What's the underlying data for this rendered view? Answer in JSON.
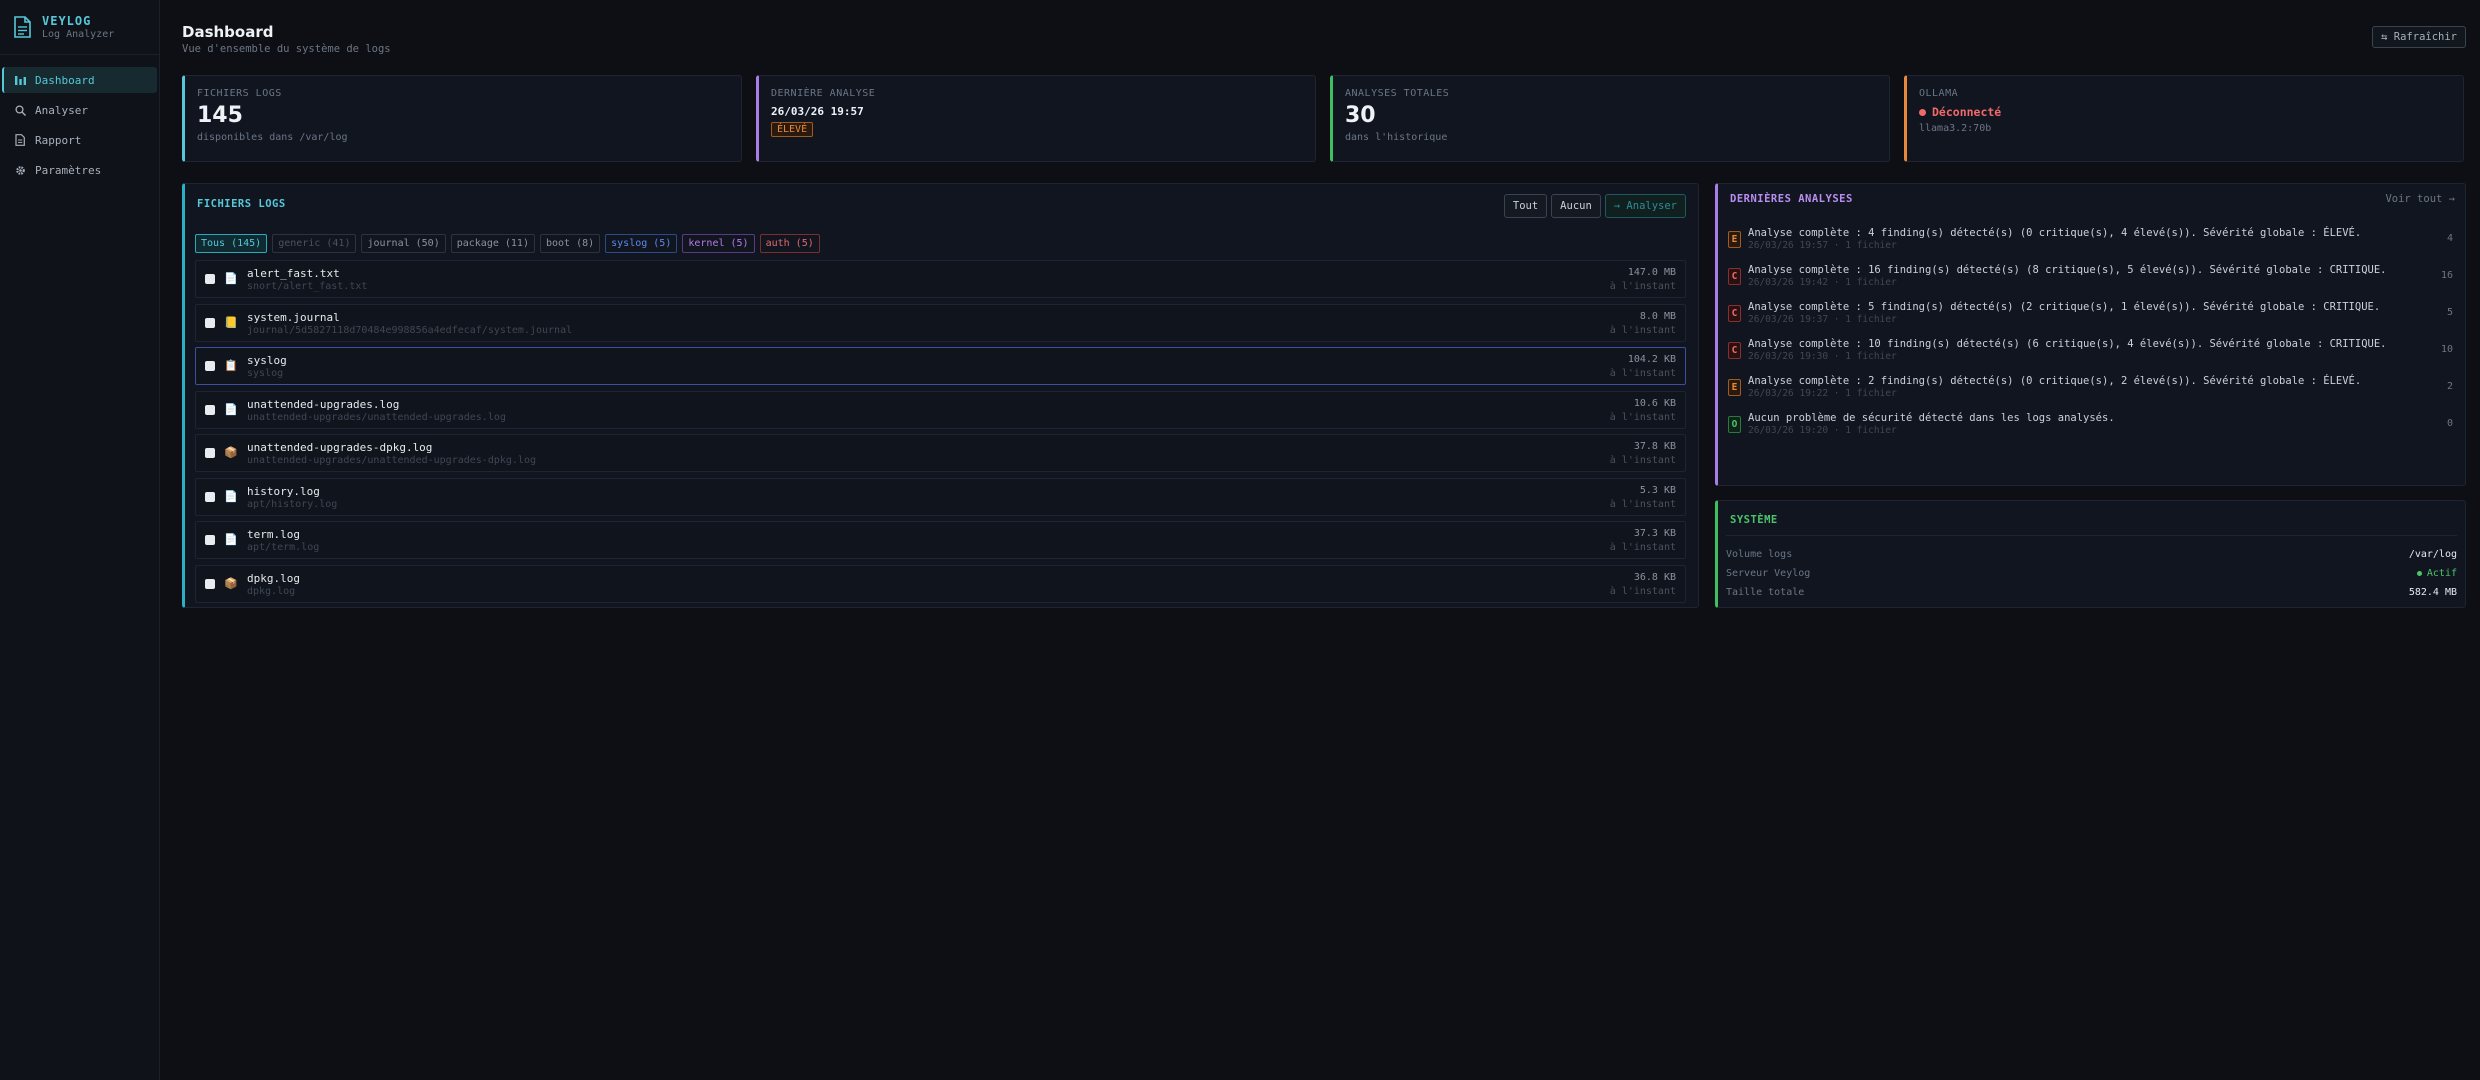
{
  "brand": {
    "name": "VEYLOG",
    "subtitle": "Log Analyzer"
  },
  "sidebar": {
    "items": [
      {
        "label": "Dashboard",
        "icon": "chart-icon",
        "active": true
      },
      {
        "label": "Analyser",
        "icon": "search-icon"
      },
      {
        "label": "Rapport",
        "icon": "document-icon"
      },
      {
        "label": "Paramètres",
        "icon": "gear-icon"
      }
    ]
  },
  "header": {
    "title": "Dashboard",
    "subtitle": "Vue d'ensemble du système de logs",
    "refresh_label": "⇆ Rafraîchir"
  },
  "cards": {
    "logs": {
      "label": "FICHIERS LOGS",
      "value": "145",
      "sub": "disponibles dans /var/log"
    },
    "last": {
      "label": "DERNIÈRE ANALYSE",
      "date": "26/03/26 19:57",
      "badge": "ÉLEVÉ"
    },
    "total": {
      "label": "ANALYSES TOTALES",
      "value": "30",
      "sub": "dans l'historique"
    },
    "ollama": {
      "label": "OLLAMA",
      "status": "Déconnecté",
      "model": "llama3.2:70b"
    }
  },
  "files_panel": {
    "title": "FICHIERS LOGS",
    "btn_all": "Tout",
    "btn_none": "Aucun",
    "btn_analyze": "→ Analyser",
    "filters": [
      "Tous (145)",
      "generic (41)",
      "journal (50)",
      "package (11)",
      "boot (8)",
      "syslog (5)",
      "kernel (5)",
      "auth (5)"
    ],
    "files": [
      {
        "name": "alert_fast.txt",
        "path": "snort/alert_fast.txt",
        "size": "147.0 MB",
        "time": "à l'instant",
        "icon": "📄"
      },
      {
        "name": "system.journal",
        "path": "journal/5d5827118d70484e998856a4edfecaf/system.journal",
        "size": "8.0 MB",
        "time": "à l'instant",
        "icon": "📒"
      },
      {
        "name": "syslog",
        "path": "syslog",
        "size": "104.2 KB",
        "time": "à l'instant",
        "icon": "📋"
      },
      {
        "name": "unattended-upgrades.log",
        "path": "unattended-upgrades/unattended-upgrades.log",
        "size": "10.6 KB",
        "time": "à l'instant",
        "icon": "📄"
      },
      {
        "name": "unattended-upgrades-dpkg.log",
        "path": "unattended-upgrades/unattended-upgrades-dpkg.log",
        "size": "37.8 KB",
        "time": "à l'instant",
        "icon": "📦"
      },
      {
        "name": "history.log",
        "path": "apt/history.log",
        "size": "5.3 KB",
        "time": "à l'instant",
        "icon": "📄"
      },
      {
        "name": "term.log",
        "path": "apt/term.log",
        "size": "37.3 KB",
        "time": "à l'instant",
        "icon": "📄"
      },
      {
        "name": "dpkg.log",
        "path": "dpkg.log",
        "size": "36.8 KB",
        "time": "à l'instant",
        "icon": "📦"
      }
    ]
  },
  "analyses": {
    "title": "DERNIÈRES ANALYSES",
    "see_all": "Voir tout →",
    "items": [
      {
        "sev": "E",
        "title": "Analyse complète : 4 finding(s) détecté(s) (0 critique(s), 4 élevé(s)). Sévérité globale : ÉLEVÉ.",
        "meta": "26/03/26 19:57 · 1 fichier",
        "count": "4"
      },
      {
        "sev": "C",
        "title": "Analyse complète : 16 finding(s) détecté(s) (8 critique(s), 5 élevé(s)). Sévérité globale : CRITIQUE.",
        "meta": "26/03/26 19:42 · 1 fichier",
        "count": "16"
      },
      {
        "sev": "C",
        "title": "Analyse complète : 5 finding(s) détecté(s) (2 critique(s), 1 élevé(s)). Sévérité globale : CRITIQUE.",
        "meta": "26/03/26 19:37 · 1 fichier",
        "count": "5"
      },
      {
        "sev": "C",
        "title": "Analyse complète : 10 finding(s) détecté(s) (6 critique(s), 4 élevé(s)). Sévérité globale : CRITIQUE.",
        "meta": "26/03/26 19:30 · 1 fichier",
        "count": "10"
      },
      {
        "sev": "E",
        "title": "Analyse complète : 2 finding(s) détecté(s) (0 critique(s), 2 élevé(s)). Sévérité globale : ÉLEVÉ.",
        "meta": "26/03/26 19:22 · 1 fichier",
        "count": "2"
      },
      {
        "sev": "O",
        "title": "Aucun problème de sécurité détecté dans les logs analysés.",
        "meta": "26/03/26 19:20 · 1 fichier",
        "count": "0"
      }
    ]
  },
  "system": {
    "title": "SYSTÈME",
    "rows": [
      {
        "label": "Volume logs",
        "value": "/var/log"
      },
      {
        "label": "Serveur Veylog",
        "value": "Actif"
      },
      {
        "label": "Taille totale",
        "value": "582.4 MB"
      }
    ]
  },
  "colors": {
    "accent": "#56c8d8",
    "purple": "#a97de8",
    "green": "#4cc46a",
    "orange": "#e8893a",
    "red": "#f06a6a"
  }
}
